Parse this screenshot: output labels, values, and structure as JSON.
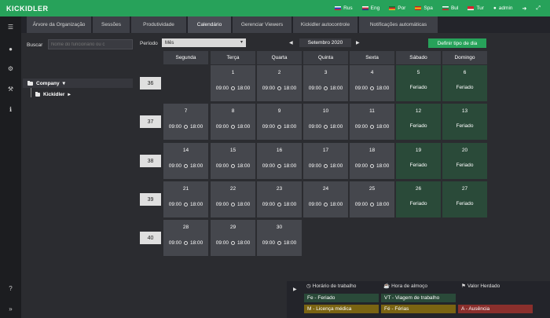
{
  "app": {
    "logo": "KICKIDLER"
  },
  "header": {
    "languages": [
      {
        "label": "Rus",
        "flag": [
          "#ffffff",
          "#1f3fbf",
          "#d5232f"
        ]
      },
      {
        "label": "Eng",
        "flag": [
          "#ffffff",
          "#c82f3a",
          "#1f3a8c"
        ]
      },
      {
        "label": "Por",
        "flag": [
          "#0b7a2c",
          "#d5232f",
          "#e6c11e"
        ]
      },
      {
        "label": "Spa",
        "flag": [
          "#c41e23",
          "#f1c40f",
          "#c41e23"
        ]
      },
      {
        "label": "Bul",
        "flag": [
          "#ffffff",
          "#1b8c4a",
          "#d5232f"
        ]
      },
      {
        "label": "Tur",
        "flag": [
          "#d5232f",
          "#d5232f",
          "#ffffff"
        ]
      }
    ],
    "user": "admin"
  },
  "tabs": [
    {
      "label": "Árvore da Organização",
      "active": false
    },
    {
      "label": "Sessões",
      "active": false
    },
    {
      "label": "Produtividade",
      "active": false
    },
    {
      "label": "Calendário",
      "active": true
    },
    {
      "label": "Gerenciar Viewers",
      "active": false
    },
    {
      "label": "Kickidler autocontrole",
      "active": false
    },
    {
      "label": "Notificações automáticas",
      "active": false
    }
  ],
  "left": {
    "search_label": "Buscar",
    "search_placeholder": "Nome do funcionário ou c",
    "tree_root": "Company",
    "tree_child": "Kickidler"
  },
  "controls": {
    "period_label": "Período",
    "period_value": "Mês",
    "month": "Setembro 2020",
    "day_type_button": "Definir tipo de dia"
  },
  "calendar": {
    "weekdays": [
      "Segunda",
      "Terça",
      "Quarta",
      "Quinta",
      "Sexta",
      "Sábado",
      "Domingo"
    ],
    "work_start": "09:00",
    "work_end": "18:00",
    "holiday_label": "Feriado",
    "weeks": [
      {
        "num": "36",
        "days": [
          null,
          {
            "d": "1"
          },
          {
            "d": "2"
          },
          {
            "d": "3"
          },
          {
            "d": "4"
          },
          {
            "d": "5",
            "holiday": true
          },
          {
            "d": "6",
            "holiday": true
          }
        ]
      },
      {
        "num": "37",
        "days": [
          {
            "d": "7"
          },
          {
            "d": "8"
          },
          {
            "d": "9"
          },
          {
            "d": "10"
          },
          {
            "d": "11"
          },
          {
            "d": "12",
            "holiday": true
          },
          {
            "d": "13",
            "holiday": true
          }
        ]
      },
      {
        "num": "38",
        "days": [
          {
            "d": "14"
          },
          {
            "d": "15"
          },
          {
            "d": "16"
          },
          {
            "d": "17"
          },
          {
            "d": "18"
          },
          {
            "d": "19",
            "holiday": true
          },
          {
            "d": "20",
            "holiday": true
          }
        ]
      },
      {
        "num": "39",
        "days": [
          {
            "d": "21"
          },
          {
            "d": "22"
          },
          {
            "d": "23"
          },
          {
            "d": "24"
          },
          {
            "d": "25"
          },
          {
            "d": "26",
            "holiday": true
          },
          {
            "d": "27",
            "holiday": true
          }
        ]
      },
      {
        "num": "40",
        "days": [
          {
            "d": "28"
          },
          {
            "d": "29"
          },
          {
            "d": "30"
          },
          null,
          null,
          null,
          null
        ]
      }
    ]
  },
  "legend": {
    "headers": [
      "Horário de trabalho",
      "Hora de almoço",
      "Valor Herdado"
    ],
    "items": [
      {
        "label": "Fe - Feriado",
        "color": "#2a4a39"
      },
      {
        "label": "VT - Viagem de trabalho",
        "color": "#2a4a39"
      },
      {
        "label": "M - Licença médica",
        "color": "#7a6412"
      },
      {
        "label": "Fé - Férias",
        "color": "#7a6412"
      },
      {
        "label": "A - Ausência",
        "color": "#8a2f2c"
      }
    ]
  }
}
